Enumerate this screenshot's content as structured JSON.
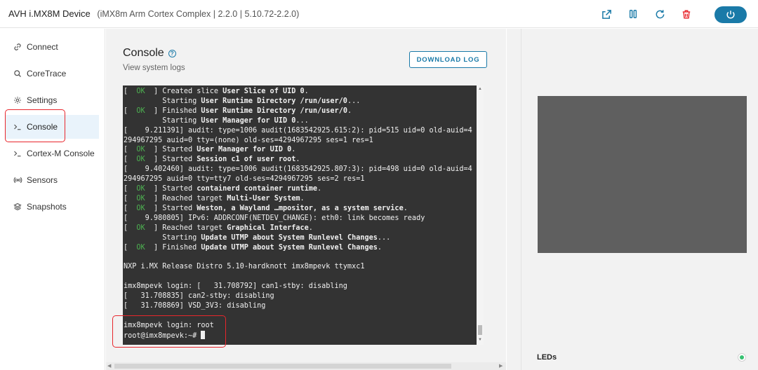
{
  "header": {
    "device_name": "AVH i.MX8M Device",
    "device_info": "(iMX8m Arm Cortex Complex | 2.2.0 | 5.10.72-2.2.0)",
    "icons": [
      "external-link-icon",
      "pause-icon",
      "refresh-icon",
      "trash-icon",
      "power-icon"
    ],
    "accent_color": "#1a7aa8",
    "delete_color": "#e8262c"
  },
  "sidebar": {
    "items": [
      {
        "label": "Connect",
        "icon": "link-icon"
      },
      {
        "label": "CoreTrace",
        "icon": "search-icon"
      },
      {
        "label": "Settings",
        "icon": "gear-icon"
      },
      {
        "label": "Console",
        "icon": "terminal-icon",
        "active": true
      },
      {
        "label": "Cortex-M Console",
        "icon": "terminal-icon"
      },
      {
        "label": "Sensors",
        "icon": "sensor-icon"
      },
      {
        "label": "Snapshots",
        "icon": "layers-icon"
      }
    ]
  },
  "console": {
    "title": "Console",
    "subtitle": "View system logs",
    "download_label": "DOWNLOAD LOG",
    "prompt": "root@imx8mpevk:~# ",
    "lines": [
      [
        {
          "t": "[  "
        },
        {
          "t": "OK",
          "c": "ok"
        },
        {
          "t": "  ] Created slice "
        },
        {
          "t": "User Slice of UID 0",
          "c": "b"
        },
        {
          "t": "."
        }
      ],
      [
        {
          "t": "         Starting "
        },
        {
          "t": "User Runtime Directory /run/user/0",
          "c": "b"
        },
        {
          "t": "..."
        }
      ],
      [
        {
          "t": "[  "
        },
        {
          "t": "OK",
          "c": "ok"
        },
        {
          "t": "  ] Finished "
        },
        {
          "t": "User Runtime Directory /run/user/0",
          "c": "b"
        },
        {
          "t": "."
        }
      ],
      [
        {
          "t": "         Starting "
        },
        {
          "t": "User Manager for UID 0",
          "c": "b"
        },
        {
          "t": "..."
        }
      ],
      [
        {
          "t": "[    9.211391] audit: type=1006 audit(1683542925.615:2): pid=515 uid=0 old-auid=4"
        }
      ],
      [
        {
          "t": "294967295 auid=0 tty=(none) old-ses=4294967295 ses=1 res=1"
        }
      ],
      [
        {
          "t": "[  "
        },
        {
          "t": "OK",
          "c": "ok"
        },
        {
          "t": "  ] Started "
        },
        {
          "t": "User Manager for UID 0",
          "c": "b"
        },
        {
          "t": "."
        }
      ],
      [
        {
          "t": "[  "
        },
        {
          "t": "OK",
          "c": "ok"
        },
        {
          "t": "  ] Started "
        },
        {
          "t": "Session c1 of user root",
          "c": "b"
        },
        {
          "t": "."
        }
      ],
      [
        {
          "t": "[    9.402460] audit: type=1006 audit(1683542925.807:3): pid=498 uid=0 old-auid=4"
        }
      ],
      [
        {
          "t": "294967295 auid=0 tty=tty7 old-ses=4294967295 ses=2 res=1"
        }
      ],
      [
        {
          "t": "[  "
        },
        {
          "t": "OK",
          "c": "ok"
        },
        {
          "t": "  ] Started "
        },
        {
          "t": "containerd container runtime",
          "c": "b"
        },
        {
          "t": "."
        }
      ],
      [
        {
          "t": "[  "
        },
        {
          "t": "OK",
          "c": "ok"
        },
        {
          "t": "  ] Reached target "
        },
        {
          "t": "Multi-User System",
          "c": "b"
        },
        {
          "t": "."
        }
      ],
      [
        {
          "t": "[  "
        },
        {
          "t": "OK",
          "c": "ok"
        },
        {
          "t": "  ] Started "
        },
        {
          "t": "Weston, a Wayland …mpositor, as a system service",
          "c": "b"
        },
        {
          "t": "."
        }
      ],
      [
        {
          "t": "[    9.980805] IPv6: ADDRCONF(NETDEV_CHANGE): eth0: link becomes ready"
        }
      ],
      [
        {
          "t": "[  "
        },
        {
          "t": "OK",
          "c": "ok"
        },
        {
          "t": "  ] Reached target "
        },
        {
          "t": "Graphical Interface",
          "c": "b"
        },
        {
          "t": "."
        }
      ],
      [
        {
          "t": "         Starting "
        },
        {
          "t": "Update UTMP about System Runlevel Changes",
          "c": "b"
        },
        {
          "t": "..."
        }
      ],
      [
        {
          "t": "[  "
        },
        {
          "t": "OK",
          "c": "ok"
        },
        {
          "t": "  ] Finished "
        },
        {
          "t": "Update UTMP about System Runlevel Changes",
          "c": "b"
        },
        {
          "t": "."
        }
      ],
      [
        {
          "t": ""
        }
      ],
      [
        {
          "t": "NXP i.MX Release Distro 5.10-hardknott imx8mpevk ttymxc1"
        }
      ],
      [
        {
          "t": ""
        }
      ],
      [
        {
          "t": "imx8mpevk login: [   31.708792] can1-stby: disabling"
        }
      ],
      [
        {
          "t": "[   31.708835] can2-stby: disabling"
        }
      ],
      [
        {
          "t": "[   31.708869] VSD_3V3: disabling"
        }
      ],
      [
        {
          "t": ""
        }
      ],
      [
        {
          "t": "imx8mpevk login: root"
        }
      ]
    ]
  },
  "panel": {
    "leds_label": "LEDs",
    "led_color": "#38c172",
    "display_color": "#5f5f5f"
  }
}
